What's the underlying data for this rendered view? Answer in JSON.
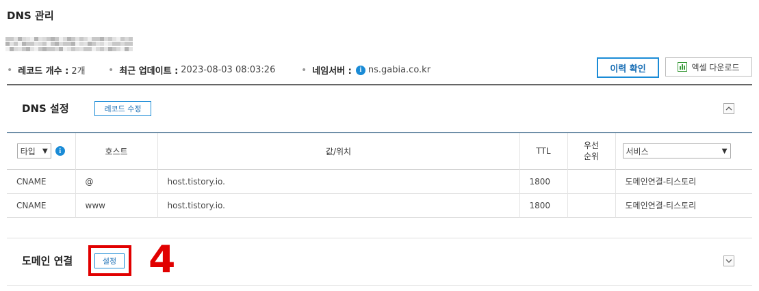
{
  "page": {
    "title": "DNS 관리"
  },
  "summary": {
    "record_count_label": "레코드 개수 :",
    "record_count_value": "2개",
    "last_update_label": "최근 업데이트 :",
    "last_update_value": "2023-08-03 08:03:26",
    "nameserver_label": "네임서버 :",
    "nameserver_value": "ns.gabia.co.kr"
  },
  "actions": {
    "history_label": "이력 확인",
    "excel_label": "엑셀 다운로드"
  },
  "dns_section": {
    "title": "DNS 설정",
    "edit_label": "레코드 수정",
    "columns": {
      "type_filter": "타입",
      "host": "호스트",
      "value": "값/위치",
      "ttl": "TTL",
      "priority_line1": "우선",
      "priority_line2": "순위",
      "service_filter": "서비스"
    },
    "rows": [
      {
        "type": "CNAME",
        "host": "@",
        "value": "host.tistory.io.",
        "ttl": "1800",
        "priority": "",
        "service": "도메인연결-티스토리"
      },
      {
        "type": "CNAME",
        "host": "www",
        "value": "host.tistory.io.",
        "ttl": "1800",
        "priority": "",
        "service": "도메인연결-티스토리"
      }
    ]
  },
  "domain_connect": {
    "title": "도메인 연결",
    "settings_label": "설정"
  },
  "annotation": {
    "step_number": "4",
    "color": "#e10000"
  },
  "colors": {
    "accent": "#1a8bd6"
  }
}
